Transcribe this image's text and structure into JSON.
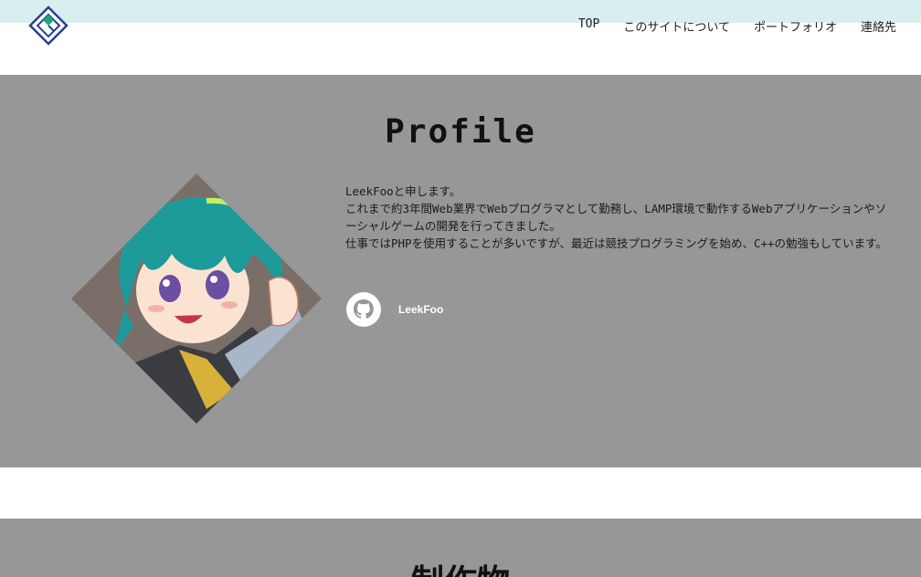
{
  "nav": {
    "items": [
      {
        "label": "TOP"
      },
      {
        "label": "このサイトについて"
      },
      {
        "label": "ポートフォリオ"
      },
      {
        "label": "連絡先"
      }
    ]
  },
  "profile": {
    "title": "Profile",
    "bio": [
      "LeekFooと申します。",
      "これまで約3年間Web業界でWebプログラマとして勤務し、LAMP環境で動作するWebアプリケーションやソーシャルゲームの開発を行ってきました。",
      "仕事ではPHPを使用することが多いですが、最近は競技プログラミングを始め、C++の勉強もしています。"
    ],
    "github": {
      "label": "LeekFoo",
      "icon": "github-icon"
    }
  },
  "works": {
    "title": "制作物"
  },
  "colors": {
    "topband": "#d9eeee",
    "section_bg": "#979797",
    "logo_blue": "#2a3f8f",
    "logo_green": "#1ea57a"
  }
}
